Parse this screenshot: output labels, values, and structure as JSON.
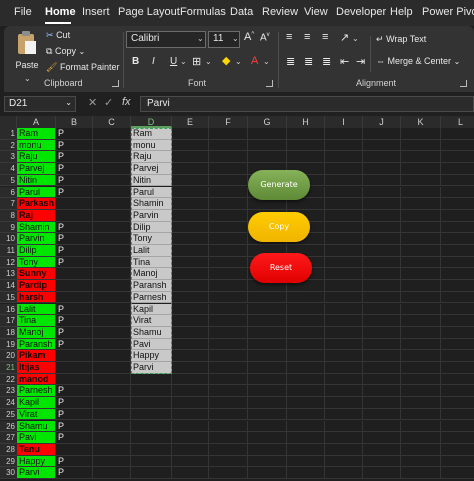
{
  "tabs": [
    "File",
    "Home",
    "Insert",
    "Page Layout",
    "Formulas",
    "Data",
    "Review",
    "View",
    "Developer",
    "Help",
    "Power Pivot"
  ],
  "clipboard": {
    "paste": "Paste",
    "cut": "Cut",
    "copy": "Copy",
    "format_painter": "Format Painter",
    "label": "Clipboard"
  },
  "font": {
    "name": "Calibri",
    "size": "11",
    "bold": "B",
    "italic": "I",
    "underline": "U",
    "grow": "A^",
    "shrink": "Av",
    "label": "Font"
  },
  "alignment": {
    "wrap_text": "Wrap Text",
    "merge_center": "Merge & Center",
    "label": "Alignment"
  },
  "formula_bar": {
    "name_box": "D21",
    "fx": "fx",
    "value": "Parvi"
  },
  "columns": [
    "A",
    "B",
    "C",
    "D",
    "E",
    "F",
    "G",
    "H",
    "I",
    "J",
    "K",
    "L"
  ],
  "selected_column": "D",
  "selected_row": 21,
  "rows": [
    {
      "n": "1",
      "a": "Ram",
      "a_color": "green",
      "b": "P",
      "d": "Ram"
    },
    {
      "n": "2",
      "a": "monu",
      "a_color": "green",
      "b": "P",
      "d": "monu"
    },
    {
      "n": "3",
      "a": "Raju",
      "a_color": "green",
      "b": "P",
      "d": "Raju"
    },
    {
      "n": "4",
      "a": "Parvej",
      "a_color": "green",
      "b": "P",
      "d": "Parvej"
    },
    {
      "n": "5",
      "a": "Nitin",
      "a_color": "green",
      "b": "P",
      "d": "Nitin"
    },
    {
      "n": "6",
      "a": "Parul",
      "a_color": "green",
      "b": "P",
      "d": "Parul"
    },
    {
      "n": "7",
      "a": "Parkash",
      "a_color": "red",
      "b": "",
      "d": "Shamin"
    },
    {
      "n": "8",
      "a": "Raj",
      "a_color": "red",
      "b": "",
      "d": "Parvin"
    },
    {
      "n": "9",
      "a": "Shamin",
      "a_color": "green",
      "b": "P",
      "d": "Dilip"
    },
    {
      "n": "10",
      "a": "Parvin",
      "a_color": "green",
      "b": "P",
      "d": "Tony"
    },
    {
      "n": "11",
      "a": "Dilip",
      "a_color": "green",
      "b": "P",
      "d": "Lalit"
    },
    {
      "n": "12",
      "a": "Tony",
      "a_color": "green",
      "b": "P",
      "d": "Tina"
    },
    {
      "n": "13",
      "a": "Sunny",
      "a_color": "red",
      "b": "",
      "d": "Manoj"
    },
    {
      "n": "14",
      "a": "Pardip",
      "a_color": "red",
      "b": "",
      "d": "Paransh"
    },
    {
      "n": "15",
      "a": "harsh",
      "a_color": "red",
      "b": "",
      "d": "Parnesh"
    },
    {
      "n": "16",
      "a": "Lalit",
      "a_color": "green",
      "b": "P",
      "d": "Kapil"
    },
    {
      "n": "17",
      "a": "Tina",
      "a_color": "green",
      "b": "P",
      "d": "Virat"
    },
    {
      "n": "18",
      "a": "Manoj",
      "a_color": "green",
      "b": "P",
      "d": "Shamu"
    },
    {
      "n": "19",
      "a": "Paransh",
      "a_color": "green",
      "b": "P",
      "d": "Pavi"
    },
    {
      "n": "20",
      "a": "Pikam",
      "a_color": "red",
      "b": "",
      "d": "Happy"
    },
    {
      "n": "21",
      "a": "Itijas",
      "a_color": "red",
      "b": "",
      "d": "Parvi"
    },
    {
      "n": "22",
      "a": "manod",
      "a_color": "red",
      "b": "",
      "d": ""
    },
    {
      "n": "23",
      "a": "Parnesh",
      "a_color": "green",
      "b": "P",
      "d": ""
    },
    {
      "n": "24",
      "a": "Kapil",
      "a_color": "green",
      "b": "P",
      "d": ""
    },
    {
      "n": "25",
      "a": "Virat",
      "a_color": "green",
      "b": "P",
      "d": ""
    },
    {
      "n": "26",
      "a": "Shamu",
      "a_color": "green",
      "b": "P",
      "d": ""
    },
    {
      "n": "27",
      "a": "Pavi",
      "a_color": "green",
      "b": "P",
      "d": ""
    },
    {
      "n": "28",
      "a": "Tanu",
      "a_color": "red",
      "b": "",
      "d": ""
    },
    {
      "n": "29",
      "a": "Happy",
      "a_color": "green",
      "b": "P",
      "d": ""
    },
    {
      "n": "30",
      "a": "Parvi",
      "a_color": "green",
      "b": "P",
      "d": ""
    }
  ],
  "buttons": {
    "generate": "Generate",
    "copy": "Copy",
    "reset": "Reset"
  },
  "colors": {
    "present_green": "#00e600",
    "absent_red": "#ff0000",
    "generate": "#6f9b44",
    "copy": "#ffc000",
    "reset": "#ff0000"
  }
}
